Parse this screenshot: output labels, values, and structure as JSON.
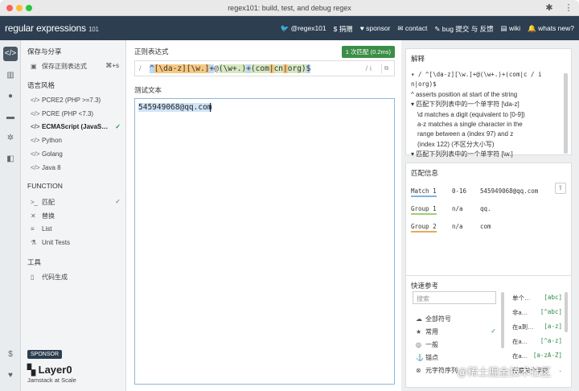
{
  "window": {
    "title": "regex101: build, test, and debug regex"
  },
  "header": {
    "logo": "regular expressions",
    "logo_version": "101",
    "nav": [
      "@regex101",
      "捐赠",
      "sponsor",
      "contact",
      "bug 提交 与 反馈",
      "wiki",
      "whats new?"
    ]
  },
  "sidebar": {
    "save_section": "保存与分享",
    "save_item": "保存正则表达式",
    "save_shortcut": "⌘+s",
    "flavor_section": "语言风格",
    "flavors": [
      "PCRE2 (PHP >=7.3)",
      "PCRE (PHP <7.3)",
      "ECMAScript (JavaS…",
      "Python",
      "Golang",
      "Java 8"
    ],
    "selected_flavor": "ECMAScript (JavaS…",
    "function_section": "FUNCTION",
    "functions": [
      "匹配",
      "替换",
      "List",
      "Unit Tests"
    ],
    "selected_function": "匹配",
    "tools_section": "工具",
    "tools": [
      "代码生成"
    ],
    "sponsor_tag": "SPONSOR",
    "sponsor_name": "Layer0",
    "sponsor_tagline": "Jamstack at Scale"
  },
  "regex": {
    "label": "正则表达式",
    "badge": "1 次匹配 (0.2ms)",
    "delimiter_open": "/",
    "flags": "/ i",
    "pattern_parts": [
      "^",
      "[\\da-z]",
      "[\\w.]",
      "+",
      "@",
      "(\\w+.)",
      "+",
      "(",
      "com",
      "|",
      "cn",
      "|",
      "org",
      ")",
      "$"
    ]
  },
  "test": {
    "label": "测试文本",
    "text": "545949068@qq.com"
  },
  "explanation": {
    "title": "解释",
    "lines": [
      "▾ / ^[\\da-z][\\w.]+@(\\w+.)+(com|c / i",
      "n|org)$",
      "^ asserts position at start of the string",
      "▾ 匹配下列列表中的一个单字符 [\\da-z]",
      "\\d matches a digit (equivalent to [0-9])",
      "a-z matches a single character in the",
      "range between a (index 97) and z",
      "(index 122) (不区分大小写)",
      "▾ 匹配下列列表中的一个单字符 [\\w.]"
    ]
  },
  "match_info": {
    "title": "匹配信息",
    "rows": [
      {
        "group": "Match 1",
        "range": "0-16",
        "value": "545949068@qq.com"
      },
      {
        "group": "Group 1",
        "range": "n/a",
        "value": "qq."
      },
      {
        "group": "Group 2",
        "range": "n/a",
        "value": "com"
      }
    ]
  },
  "quick_ref": {
    "title": "快速参考",
    "search_placeholder": "搜索",
    "categories": [
      "全部符号",
      "常用",
      "一般",
      "锚点",
      "元字符序列"
    ],
    "selected": "常用",
    "tokens": [
      {
        "label": "单个…",
        "token": "[abc]"
      },
      {
        "label": "非a…",
        "token": "[^abc]"
      },
      {
        "label": "在a到…",
        "token": "[a-z]"
      },
      {
        "label": "在a…",
        "token": "[^a-z]"
      },
      {
        "label": "在a…",
        "token": "[a-zA-Z]"
      },
      {
        "label": "任意单个字符",
        "token": "."
      }
    ]
  },
  "watermark": "@稀土掘金技术社区",
  "colors": {
    "header_bg": "#2c3e50",
    "match_badge": "#3b8e46",
    "accent_orange": "#f6c880",
    "accent_blue": "#bcd9f2"
  }
}
